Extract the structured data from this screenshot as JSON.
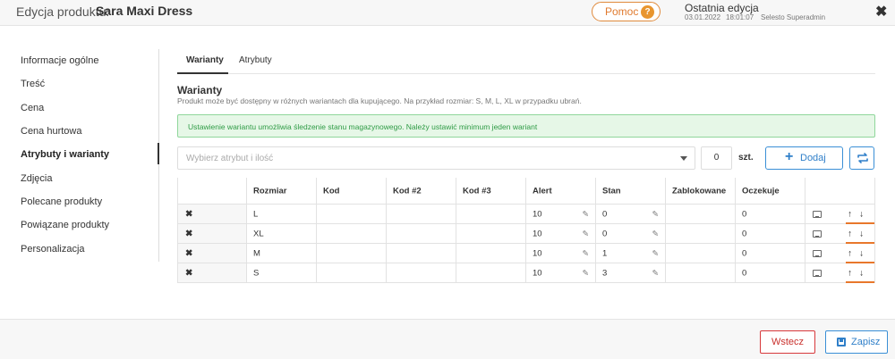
{
  "header": {
    "title": "Edycja produktu:",
    "product": "Sara Maxi Dress",
    "help_label": "Pomoc",
    "help_icon": "?",
    "last_edit_label": "Ostatnia edycja",
    "last_edit_date": "03.01.2022",
    "last_edit_time": "18:01:07",
    "last_edit_user": "Selesto Superadmin",
    "close_icon": "✖"
  },
  "sidebar": {
    "items": [
      {
        "label": "Informacje ogólne"
      },
      {
        "label": "Treść"
      },
      {
        "label": "Cena"
      },
      {
        "label": "Cena hurtowa"
      },
      {
        "label": "Atrybuty i warianty",
        "active": true
      },
      {
        "label": "Zdjęcia"
      },
      {
        "label": "Polecane produkty"
      },
      {
        "label": "Powiązane produkty"
      },
      {
        "label": "Personalizacja"
      }
    ]
  },
  "tabs": [
    {
      "label": "Warianty",
      "active": true
    },
    {
      "label": "Atrybuty"
    }
  ],
  "section": {
    "title": "Warianty",
    "description": "Produkt może być dostępny w różnych wariantach dla kupującego. Na przykład rozmiar: S, M, L, XL w przypadku ubrań."
  },
  "alert": {
    "text": "Ustawienie wariantu umożliwia śledzenie stanu magazynowego. Należy ustawić minimum jeden wariant",
    "color": "#2e9b45"
  },
  "controls": {
    "select_placeholder": "Wybierz atrybut i ilość",
    "quantity": "0",
    "unit": "szt.",
    "add_label": "Dodaj",
    "add_icon": "+"
  },
  "table": {
    "columns": [
      "Rozmiar",
      "Kod",
      "Kod #2",
      "Kod #3",
      "Alert",
      "Stan",
      "Zablokowane",
      "Oczekuje"
    ],
    "rows": [
      {
        "rozmiar": "L",
        "kod": "",
        "kod2": "",
        "kod3": "",
        "alert": "10",
        "stan": "0",
        "zablokowane": "",
        "oczekuje": "0"
      },
      {
        "rozmiar": "XL",
        "kod": "",
        "kod2": "",
        "kod3": "",
        "alert": "10",
        "stan": "0",
        "zablokowane": "",
        "oczekuje": "0"
      },
      {
        "rozmiar": "M",
        "kod": "",
        "kod2": "",
        "kod3": "",
        "alert": "10",
        "stan": "1",
        "zablokowane": "",
        "oczekuje": "0"
      },
      {
        "rozmiar": "S",
        "kod": "",
        "kod2": "",
        "kod3": "",
        "alert": "10",
        "stan": "3",
        "zablokowane": "",
        "oczekuje": "0"
      }
    ],
    "remove_icon": "✖",
    "edit_icon": "✎",
    "up_icon": "↑",
    "down_icon": "↓"
  },
  "footer": {
    "back_label": "Wstecz",
    "save_label": "Zapisz"
  },
  "colors": {
    "accent_blue": "#2f7fc9",
    "help_orange": "#e07a2e",
    "danger_red": "#c9302c",
    "success_green": "#2e9b45"
  }
}
